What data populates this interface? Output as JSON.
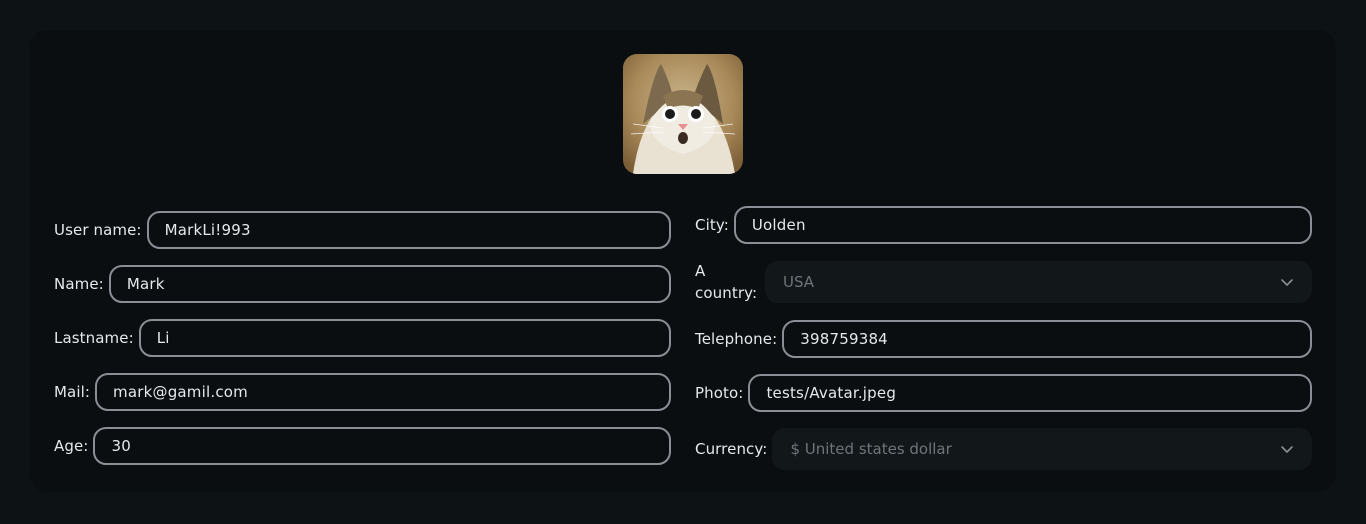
{
  "profile": {
    "avatar_icon": "cat-photo-icon",
    "left": {
      "username": {
        "label": "User name:",
        "value": "MarkLi!993"
      },
      "name": {
        "label": "Name:",
        "value": "Mark"
      },
      "lastname": {
        "label": "Lastname:",
        "value": "Li"
      },
      "mail": {
        "label": "Mail:",
        "value": "mark@gamil.com"
      },
      "age": {
        "label": "Age:",
        "value": "30"
      }
    },
    "right": {
      "city": {
        "label": "City:",
        "value": "Uolden"
      },
      "country": {
        "label": "A country:",
        "value": "USA",
        "icon": "chevron-down-icon"
      },
      "telephone": {
        "label": "Telephone:",
        "value": "398759384"
      },
      "photo": {
        "label": "Photo:",
        "value": "tests/Avatar.jpeg"
      },
      "currency": {
        "label": "Currency:",
        "value": "$ United states dollar",
        "icon": "chevron-down-icon"
      }
    }
  },
  "colors": {
    "background": "#0d1215",
    "card": "#0a0e11",
    "input_border": "#8a8f95",
    "select_bg": "#121719",
    "muted_text": "#6e757c"
  }
}
